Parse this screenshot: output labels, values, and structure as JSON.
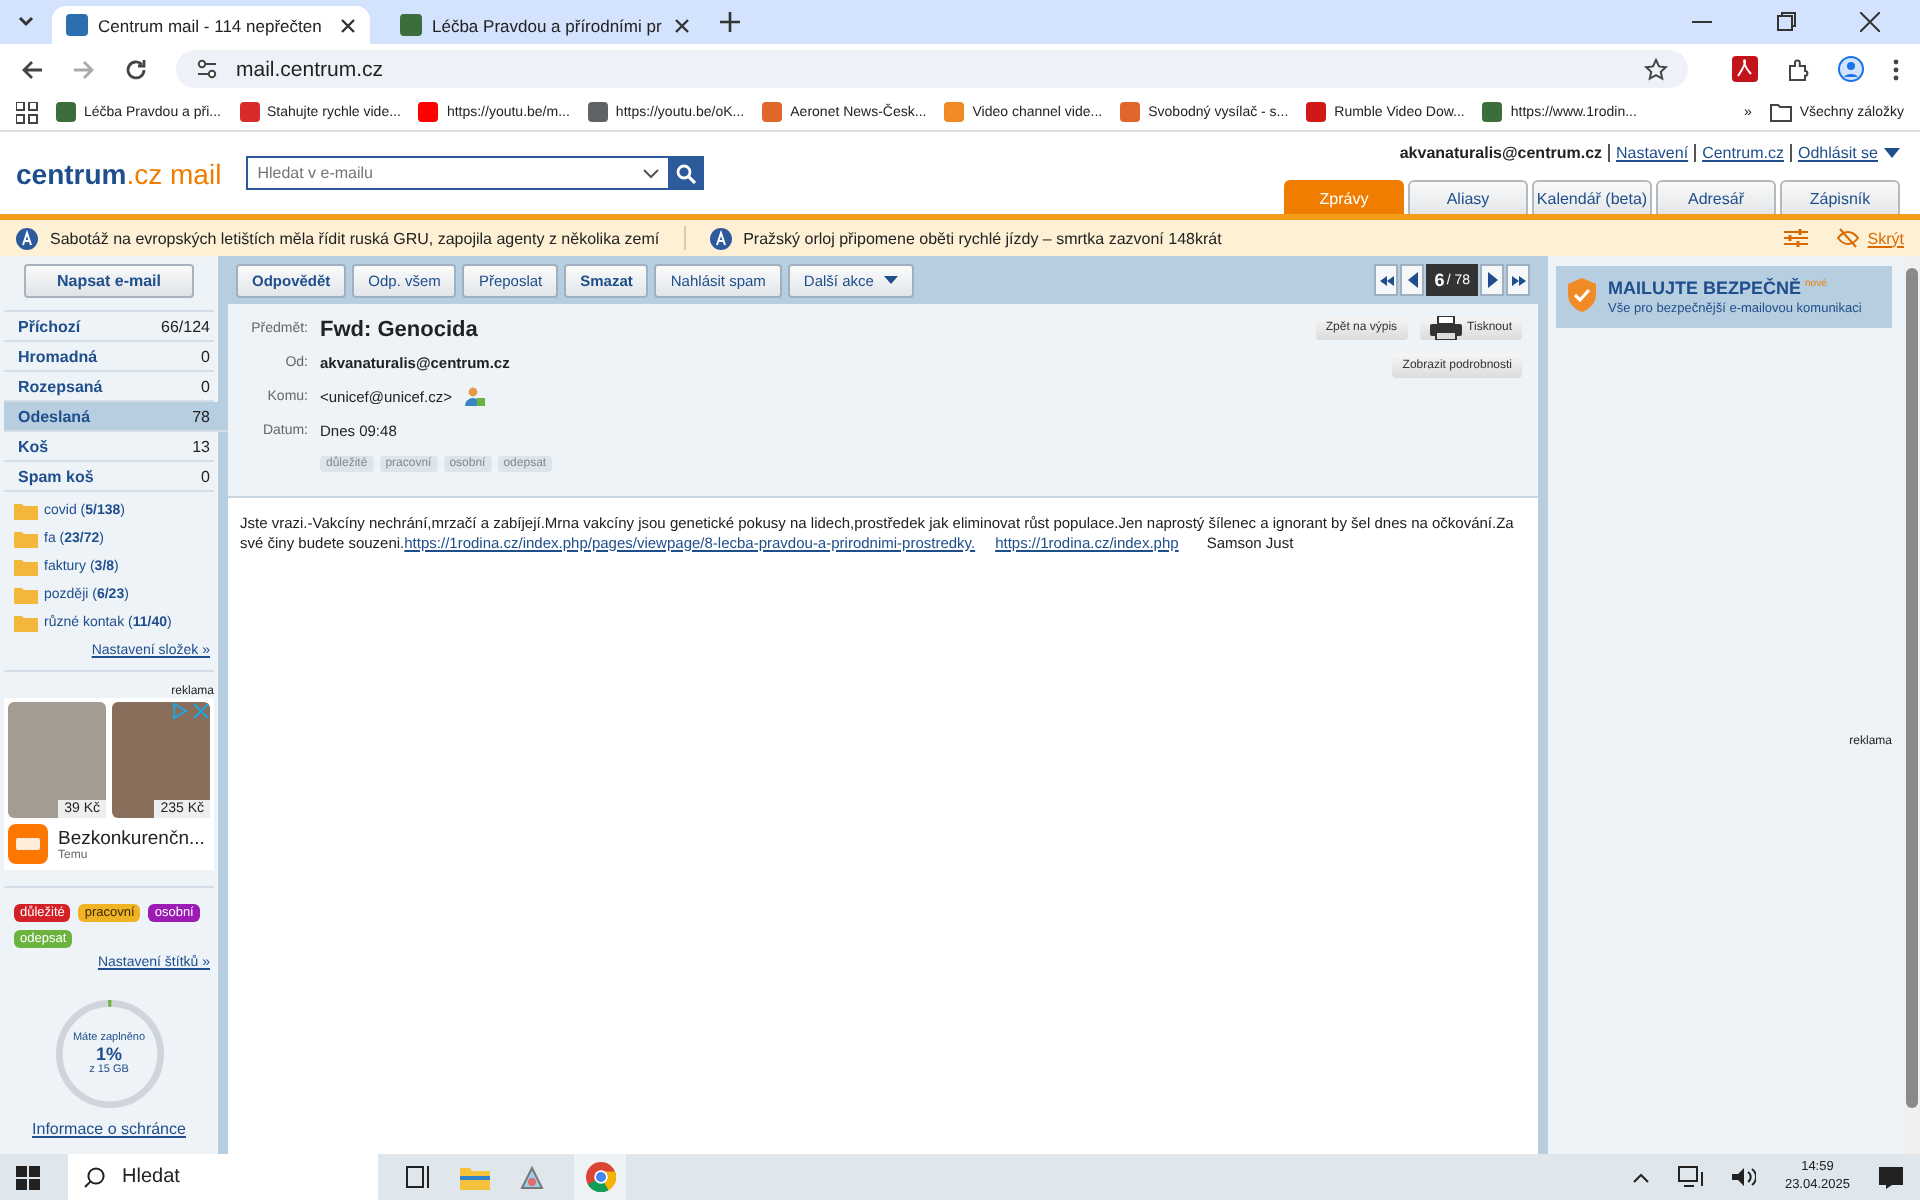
{
  "browser": {
    "tabs": [
      {
        "title": "Centrum mail - 114 nepřečten",
        "selected": true
      },
      {
        "title": "Léčba Pravdou a přírodními pr",
        "selected": false
      }
    ],
    "url": "mail.centrum.cz",
    "bookmarks": [
      {
        "title": "Léčba Pravdou a při...",
        "color": "#3b6e3b"
      },
      {
        "title": "Stahujte rychle vide...",
        "color": "#d92b2b"
      },
      {
        "title": "https://youtu.be/m...",
        "color": "#ff0000"
      },
      {
        "title": "https://youtu.be/oK...",
        "color": "#5f6368"
      },
      {
        "title": "Aeronet News-Česk...",
        "color": "#e0662b"
      },
      {
        "title": "Video channel vide...",
        "color": "#f08a24"
      },
      {
        "title": "Svobodný vysílač - s...",
        "color": "#e0662b"
      },
      {
        "title": "Rumble Video Dow...",
        "color": "#d01818"
      },
      {
        "title": "https://www.1rodin...",
        "color": "#3b6e3b"
      }
    ],
    "bookmarks_more": "»",
    "all_bookmarks": "Všechny záložky"
  },
  "mail_header": {
    "logo": {
      "brand": "centrum",
      "domain": ".cz",
      "product": "mail"
    },
    "user": "akvanaturalis@centrum.cz",
    "links": [
      "Nastavení",
      "Centrum.cz",
      "Odhlásit se"
    ],
    "search_placeholder": "Hledat v e-mailu",
    "nav_tabs": [
      {
        "label": "Zprávy",
        "selected": true
      },
      {
        "label": "Aliasy",
        "selected": false
      },
      {
        "label": "Kalendář (beta)",
        "selected": false
      },
      {
        "label": "Adresář",
        "selected": false
      },
      {
        "label": "Zápisník",
        "selected": false
      }
    ]
  },
  "news": {
    "items": [
      "Sabotáž na evropských letištích měla řídit ruská GRU, zapojila agenty z několika zemí",
      "Pražský orloj připomene oběti rychlé jízdy – smrtka zazvoní 148krát"
    ],
    "hide": "Skrýt"
  },
  "sidebar": {
    "compose": "Napsat e-mail",
    "folders": [
      {
        "name": "Příchozí",
        "count": "66/124",
        "selected": false
      },
      {
        "name": "Hromadná",
        "count": "0",
        "selected": false
      },
      {
        "name": "Rozepsaná",
        "count": "0",
        "selected": false
      },
      {
        "name": "Odeslaná",
        "count": "78",
        "selected": true
      },
      {
        "name": "Koš",
        "count": "13",
        "selected": false
      },
      {
        "name": "Spam koš",
        "count": "0",
        "selected": false
      }
    ],
    "custom_folders": [
      {
        "name": "covid (**5/138**)"
      },
      {
        "name": "fa (**23/72**)"
      },
      {
        "name": "faktury (**3/8**)"
      },
      {
        "name": "později (**6/23**)"
      },
      {
        "name": "různé kontak (**11/40**)"
      }
    ],
    "folder_settings": "Nastavení složek »",
    "ad_label": "reklama",
    "ad": {
      "prices": [
        "39 Kč",
        "235 Kč"
      ],
      "title": "Bezkonkurenčn...",
      "brand": "Temu"
    },
    "tags": [
      {
        "name": "důležité",
        "color": "#d42027"
      },
      {
        "name": "pracovní",
        "color": "#f0b323"
      },
      {
        "name": "osobní",
        "color": "#9b1bb4"
      },
      {
        "name": "odepsat",
        "color": "#6cb33e"
      }
    ],
    "tag_settings": "Nastavení štítků »",
    "storage": {
      "label": "Máte zaplněno",
      "value": "1%",
      "total": "z 15 GB",
      "level": 0.01,
      "link": "Informace o schránce"
    }
  },
  "toolbar": {
    "buttons": [
      "Odpovědět",
      "Odp. všem",
      "Přeposlat",
      "Smazat",
      "Nahlásit spam"
    ],
    "more": "Další akce",
    "pager": {
      "current": "6",
      "total": "/ 78"
    }
  },
  "message": {
    "subject_label": "Předmět:",
    "subject": "Fwd: Genocida",
    "fields": [
      {
        "label": "Od:",
        "value": "akvanaturalis@centrum.cz",
        "kind": "sender"
      },
      {
        "label": "Komu:",
        "value": "<unicef@unicef.cz>",
        "kind": "recipient"
      },
      {
        "label": "Datum:",
        "value": "Dnes 09:48",
        "kind": "date"
      }
    ],
    "back": "Zpět na výpis",
    "print": "Tisknout",
    "details": "Zobrazit podrobnosti",
    "tags": [
      "důležité",
      "pracovní",
      "osobní",
      "odepsat"
    ],
    "body": "Jste vrazi.-Vakcíny nechrání,mrzačí a zabíjejí.Mrna vakcíny jsou genetické pokusy na lidech,prostředek jak eliminovat růst populace.Jen naprostý šílenec a ignorant by šel dnes na očkování.Za své činy budete souzeni.",
    "links": [
      "https://1rodina.cz/index.php/pages/viewpage/8-lecba-pravdou-a-prirodnimi-prostredky.",
      "https://1rodina.cz/index.php"
    ],
    "signature": "Samson Just"
  },
  "promo": {
    "title": "MAILUJTE BEZPEČNĚ",
    "badge": "nové",
    "text": "Vše pro bezpečnější e-mailovou komunikaci",
    "ad_label": "reklama"
  },
  "taskbar": {
    "search": "Hledat",
    "time": "14:59",
    "date": "23.04.2025"
  }
}
